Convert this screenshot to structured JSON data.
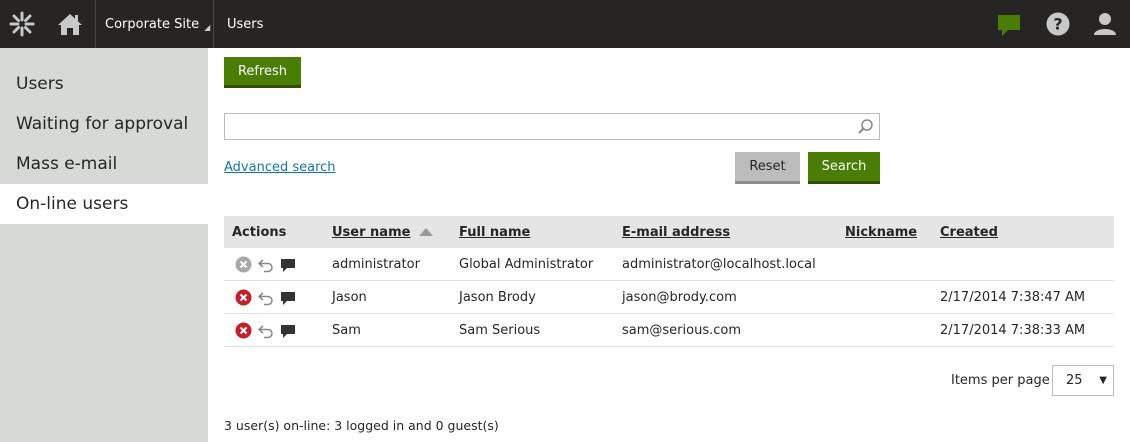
{
  "header": {
    "site_label": "Corporate Site",
    "app_title": "Users",
    "icons": [
      "kentico-logo-icon",
      "home-icon",
      "chat-icon",
      "help-icon",
      "user-icon"
    ],
    "chat_color": "#497d04"
  },
  "sidebar": {
    "items": [
      {
        "label": "Users",
        "active": false
      },
      {
        "label": "Waiting for approval",
        "active": false
      },
      {
        "label": "Mass e-mail",
        "active": false
      },
      {
        "label": "On-line users",
        "active": true
      }
    ]
  },
  "toolbar": {
    "refresh_label": "Refresh"
  },
  "search": {
    "value": "",
    "advanced_label": "Advanced search",
    "reset_label": "Reset",
    "search_label": "Search"
  },
  "table": {
    "columns": [
      "Actions",
      "User name",
      "Full name",
      "E-mail address",
      "Nickname",
      "Created"
    ],
    "rows": [
      {
        "user_name": "administrator",
        "full_name": "Global Administrator",
        "email": "administrator@localhost.local",
        "nickname": "",
        "created": "",
        "kick_enabled": false
      },
      {
        "user_name": "Jason",
        "full_name": "Jason Brody",
        "email": "jason@brody.com",
        "nickname": "",
        "created": "2/17/2014 7:38:47 AM",
        "kick_enabled": true
      },
      {
        "user_name": "Sam",
        "full_name": "Sam Serious",
        "email": "sam@serious.com",
        "nickname": "",
        "created": "2/17/2014 7:38:33 AM",
        "kick_enabled": true
      }
    ]
  },
  "paging": {
    "items_per_page_label": "Items per page",
    "items_per_page_value": "25"
  },
  "summary_text": "3 user(s) on-line: 3 logged in and 0 guest(s)"
}
